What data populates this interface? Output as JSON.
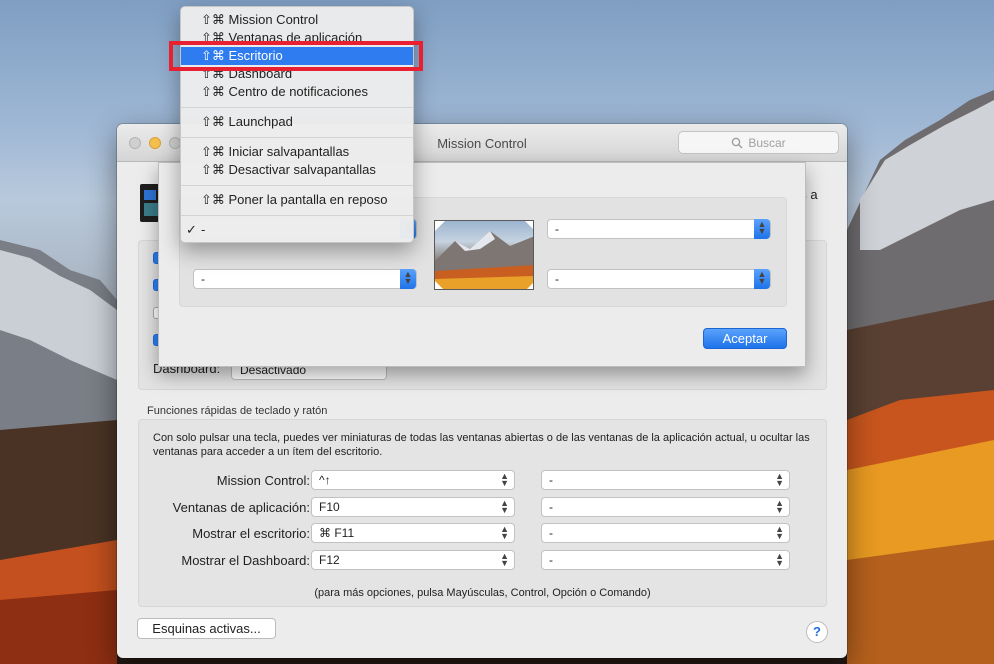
{
  "window": {
    "title": "Mission Control",
    "search_placeholder": "Buscar",
    "cut_text": "es a",
    "dashboard_label": "Dashboard:",
    "dashboard_value": "Desactivado",
    "checkboxes": [
      true,
      true,
      false,
      true
    ]
  },
  "shortcuts": {
    "section_title": "Funciones rápidas de teclado y ratón",
    "description": "Con solo pulsar una tecla, puedes ver miniaturas de todas las ventanas abiertas o de las ventanas de la aplicación actual, u ocultar las ventanas para acceder a un ítem del escritorio.",
    "rows": [
      {
        "label": "Mission Control:",
        "key": "^↑",
        "mouse": "-"
      },
      {
        "label": "Ventanas de aplicación:",
        "key": "F10",
        "mouse": "-"
      },
      {
        "label": "Mostrar el escritorio:",
        "key": "⌘ F11",
        "mouse": "-"
      },
      {
        "label": "Mostrar el Dashboard:",
        "key": "F12",
        "mouse": "-"
      }
    ],
    "note": "(para más opciones, pulsa Mayúsculas, Control, Opción o Comando)"
  },
  "footer": {
    "hot_corners_button": "Esquinas activas...",
    "help_label": "?"
  },
  "sheet": {
    "top_right": "-",
    "bottom_left": "-",
    "bottom_right": "-",
    "ok_button": "Aceptar"
  },
  "menu": {
    "items": [
      {
        "label": "⇧⌘ Mission Control"
      },
      {
        "label": "⇧⌘ Ventanas de aplicación"
      },
      {
        "label": "⇧⌘ Escritorio"
      },
      {
        "label": "⇧⌘ Dashboard"
      },
      {
        "label": "⇧⌘ Centro de notificaciones"
      },
      {
        "label": "⇧⌘ Launchpad"
      },
      {
        "label": "⇧⌘ Iniciar salvapantallas"
      },
      {
        "label": "⇧⌘ Desactivar salvapantallas"
      },
      {
        "label": "⇧⌘ Poner la pantalla en reposo"
      },
      {
        "label": "-"
      }
    ],
    "highlighted_index": 2,
    "checked_index": 9,
    "check_mark": "✓"
  },
  "colors": {
    "accent": "#2e7cf0",
    "annotation": "#e8202f"
  },
  "icons": {
    "search": "magnifier-icon",
    "select": "up-down-arrows-icon",
    "check": "checkmark-icon"
  }
}
